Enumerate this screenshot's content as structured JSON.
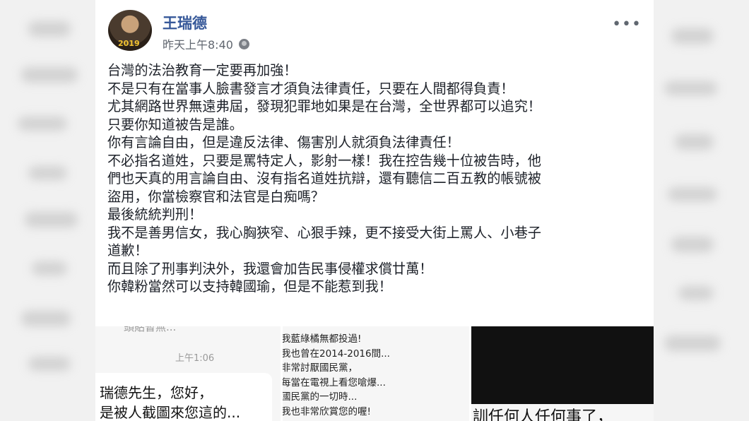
{
  "post": {
    "author": "王瑞德",
    "timestamp": "昨天上午8:40",
    "avatar_text": "2019",
    "more_label": "•••",
    "lines": [
      "台灣的法治教育一定要再加強！",
      "不是只有在當事人臉書發言才須負法律責任，只要在人間都得負責！",
      "尤其網路世界無遠弗屆，發現犯罪地如果是在台灣，全世界都可以追究！",
      "只要你知道被告是誰。",
      "你有言論自由，但是違反法律、傷害別人就須負法律責任！",
      "不必指名道姓，只要是罵特定人，影射一樣！我在控告幾十位被告時，他",
      "們也天真的用言論自由、沒有指名道姓抗辯，還有聽信二百五教的帳號被",
      "盜用，你當檢察官和法官是白痴嗎？",
      "最後統統判刑！",
      "我不是善男信女，我心胸狹窄、心狠手辣，更不接受大街上罵人、小巷子",
      "道歉！",
      "而且除了刑事判決外，我還會加告民事侵權求償廿萬！",
      "你韓粉當然可以支持韓國瑜，但是不能惹到我！"
    ]
  },
  "attachments": {
    "thumb1": {
      "top_text": "頭貼暫無...",
      "time": "上午1:06",
      "line1": "瑞德先生，您好，",
      "line2": "是被人截圖來您這的..."
    },
    "thumb2": {
      "lines": [
        "我藍綠橘無都投過!",
        "我也曾在2014-2016間...",
        "非常討厭國民黨，",
        "每當在電視上看您嗆爆...",
        "國民黨的一切時...",
        "我也非常欣賞您的喔!"
      ]
    },
    "thumb3": {
      "text": "訓任何人任何事了，"
    }
  }
}
